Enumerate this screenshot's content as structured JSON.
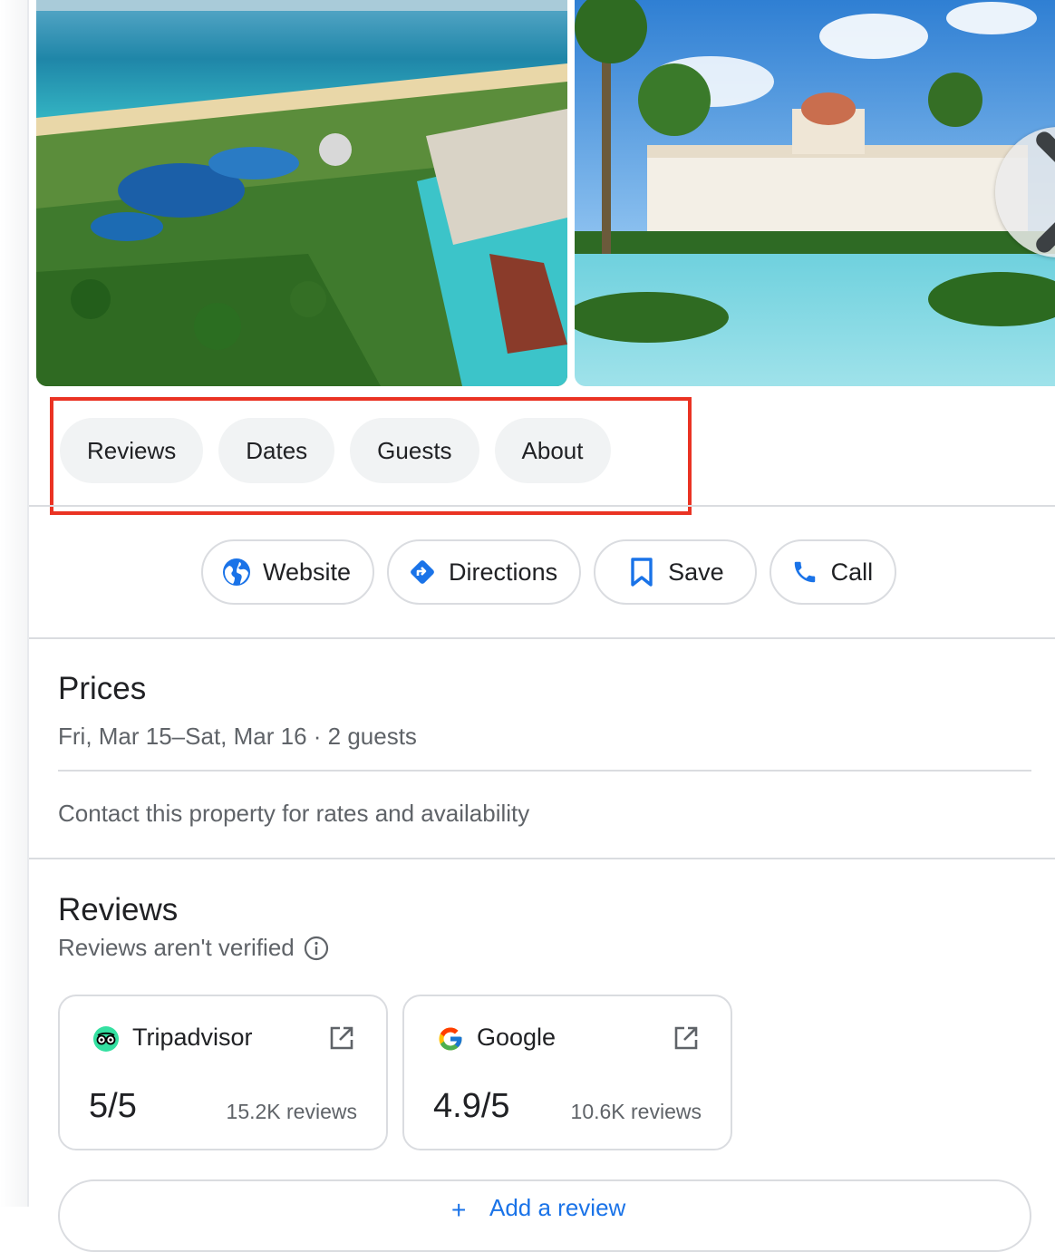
{
  "chips": [
    "Reviews",
    "Dates",
    "Guests",
    "About"
  ],
  "actions": {
    "website": "Website",
    "directions": "Directions",
    "save": "Save",
    "call": "Call"
  },
  "prices": {
    "title": "Prices",
    "dates_guests": "Fri, Mar 15–Sat, Mar 16 · 2 guests",
    "contact": "Contact this property for rates and availability"
  },
  "reviews": {
    "title": "Reviews",
    "note": "Reviews aren't verified",
    "sources": [
      {
        "name": "Tripadvisor",
        "score": "5/5",
        "count": "15.2K reviews"
      },
      {
        "name": "Google",
        "score": "4.9/5",
        "count": "10.6K reviews"
      }
    ],
    "add_review": "Add a review"
  },
  "colors": {
    "accent_blue": "#1a73e8",
    "highlight_red": "#ea3323",
    "chip_bg": "#f1f3f4"
  },
  "icons": [
    "globe-icon",
    "directions-icon",
    "bookmark-icon",
    "phone-icon",
    "info-icon",
    "external-link-icon",
    "chevron-right-icon",
    "tripadvisor-icon",
    "google-g-icon",
    "plus-icon"
  ]
}
